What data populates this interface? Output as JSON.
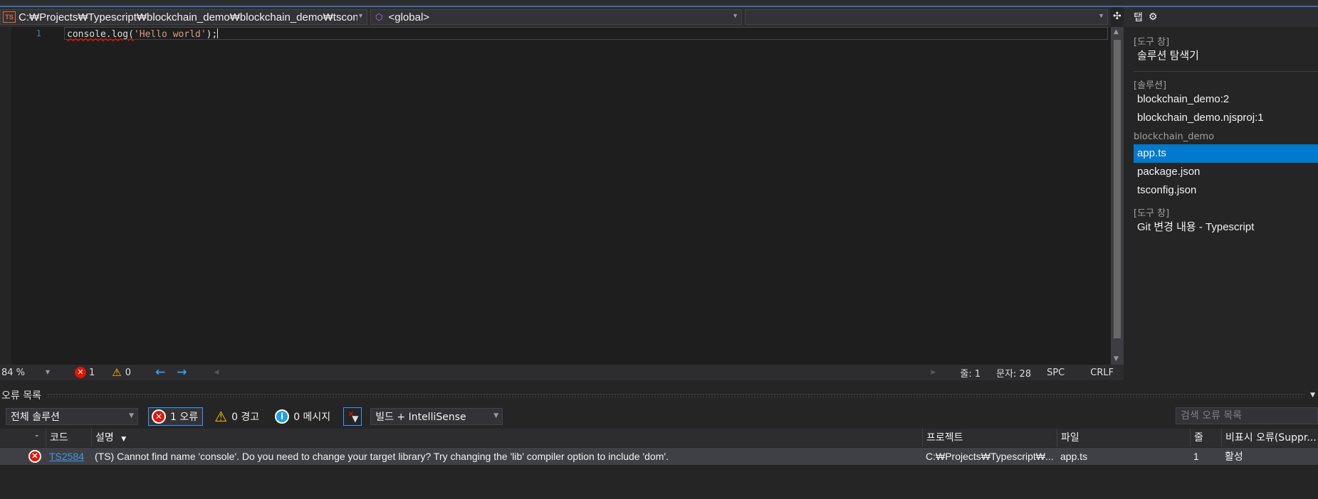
{
  "nav": {
    "file_badge": "TS",
    "file_path": "C:₩Projects₩Typescript₩blockchain_demo₩blockchain_demo₩tsconfi",
    "scope": "<global>",
    "member": ""
  },
  "editor": {
    "line_number": "1",
    "code_prefix": "console.log(",
    "code_string": "'Hello world'",
    "code_suffix": ");"
  },
  "side_panel": {
    "header_label": "탭",
    "header_icon": "gear-icon",
    "sections": [
      {
        "label": "[도구 창]",
        "items": [
          "솔루션 탐색기"
        ]
      },
      {
        "label": "[솔루션]",
        "items": [
          "blockchain_demo:2",
          "blockchain_demo.njsproj:1"
        ]
      },
      {
        "label": "blockchain_demo",
        "items": [
          "app.ts",
          "package.json",
          "tsconfig.json"
        ],
        "selected": "app.ts"
      },
      {
        "label": "[도구 창]",
        "items": [
          "Git 변경 내용 - Typescript"
        ]
      }
    ]
  },
  "editor_status": {
    "zoom": "84 %",
    "errors": "1",
    "warnings": "0",
    "line": "줄: 1",
    "column": "문자: 28",
    "spacing": "SPC",
    "line_ending": "CRLF"
  },
  "error_list": {
    "title": "오류 목록",
    "scope": "전체 솔루션",
    "errors_btn": "1 오류",
    "warnings_btn": "0 경고",
    "messages_btn": "0 메시지",
    "source": "빌드 + IntelliSense",
    "search_placeholder": "검색 오류 목록",
    "columns": {
      "code": "코드",
      "description": "설명",
      "project": "프로젝트",
      "file": "파일",
      "line": "줄",
      "suppression": "비표시 오류(Suppr..."
    },
    "rows": [
      {
        "code": "TS2584",
        "description": "(TS) Cannot find name 'console'. Do you need to change your target library? Try changing the 'lib' compiler option to include 'dom'.",
        "project": "C:₩Projects₩Typescript₩...",
        "file": "app.ts",
        "line": "1",
        "suppression": "활성"
      }
    ]
  },
  "colors": {
    "accent": "#007acc",
    "error": "#e51400",
    "warning": "#ffcc00",
    "editor_bg": "#1e1e1e"
  }
}
